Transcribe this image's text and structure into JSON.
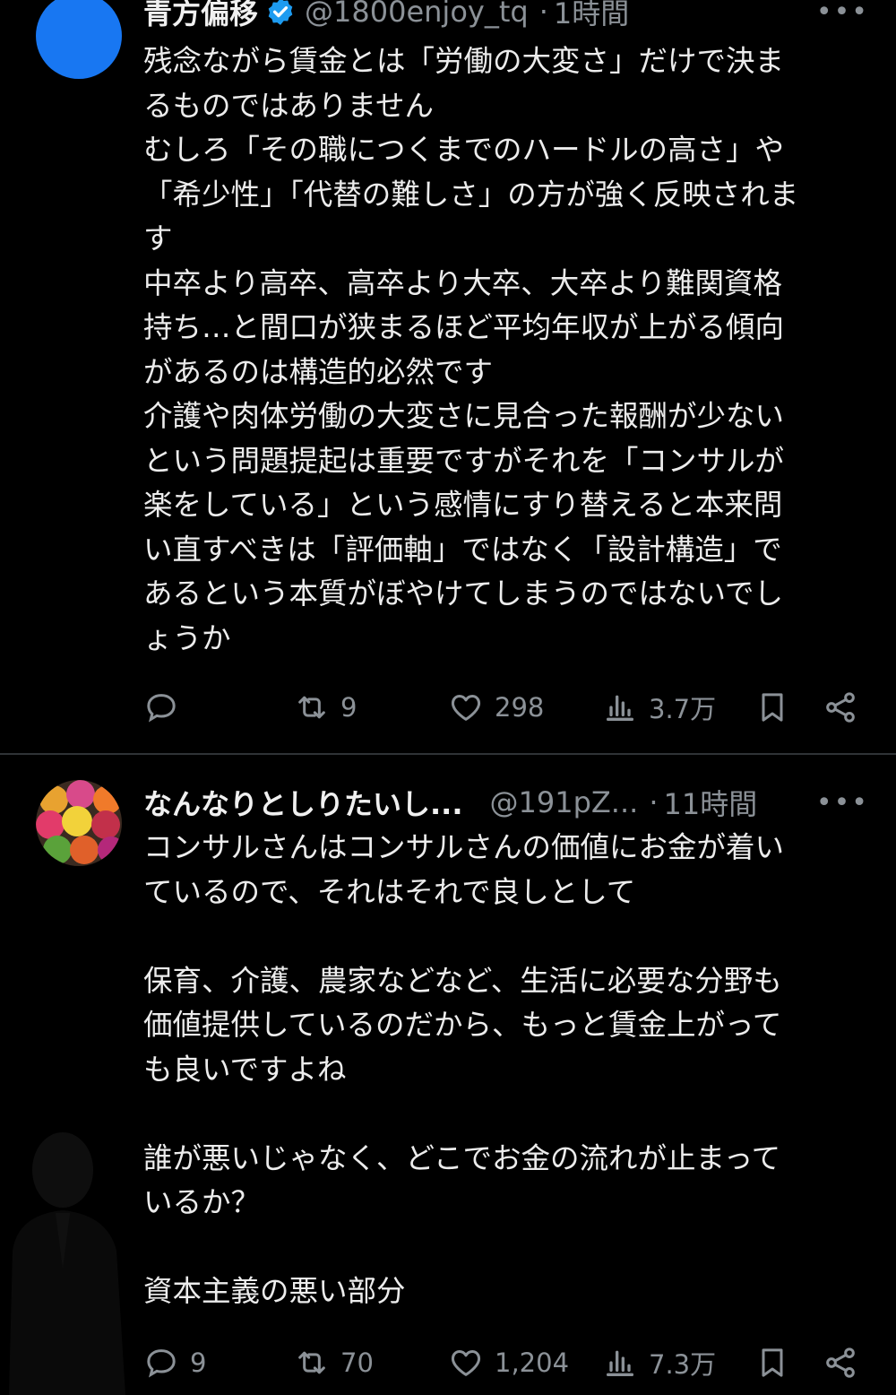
{
  "tweets": [
    {
      "name": "青方偏移",
      "handle": "@1800enjoy_tq",
      "time": "1時間",
      "more": "•••",
      "lines": [
        "残念ながら賃金とは「労働の大変さ」だけで決ま",
        "るものではありません",
        "むしろ「その職につくまでのハードルの高さ」や",
        "「希少性」「代替の難しさ」の方が強く反映されま",
        "す",
        "中卒より高卒、高卒より大卒、大卒より難関資格",
        "持ち…と間口が狭まるほど平均年収が上がる傾向",
        "があるのは構造的必然です",
        "介護や肉体労働の大変さに見合った報酬が少ない",
        "という問題提起は重要ですがそれを「コンサルが",
        "楽をしている」という感情にすり替えると本来問",
        "い直すべきは「評価軸」ではなく「設計構造」で",
        "あるという本質がぼやけてしまうのではないでし",
        "ょうか"
      ],
      "stats": {
        "replies": "",
        "retweets": "9",
        "likes": "298",
        "views": "3.7万"
      }
    },
    {
      "name": "なんなりとしりたいし...",
      "handle": "@191pZ...",
      "time": "11時間",
      "more": "•••",
      "lines": [
        "コンサルさんはコンサルさんの価値にお金が着い",
        "ているので、それはそれで良しとして",
        "",
        "保育、介護、農家などなど、生活に必要な分野も",
        "価値提供しているのだから、もっと賃金上がって",
        "も良いですよね",
        "",
        "誰が悪いじゃなく、どこでお金の流れが止まって",
        "いるか？",
        "",
        "資本主義の悪い部分"
      ],
      "stats": {
        "replies": "9",
        "retweets": "70",
        "likes": "1,204",
        "views": "7.3万"
      }
    }
  ],
  "icons": {
    "reply": "speech-bubble",
    "retweet": "retweet-arrows",
    "like": "heart",
    "views": "bar-chart",
    "bookmark": "bookmark",
    "share": "share-nodes"
  },
  "colors": {
    "background": "#000000",
    "text": "#ececec",
    "muted": "#8b9197",
    "verified": "#1d9bf0",
    "avatar1": "#1877f2"
  }
}
